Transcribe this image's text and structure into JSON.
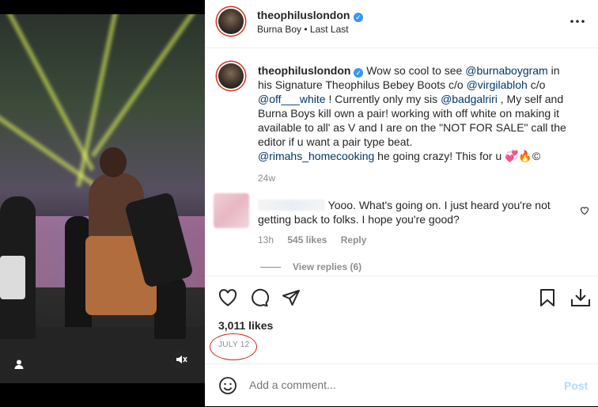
{
  "post": {
    "username": "theophiluslondon",
    "music": "Burna Boy • Last Last"
  },
  "caption": {
    "username": "theophiluslondon",
    "p1": " Wow so cool to see ",
    "m1": "@burnaboygram",
    "p2": " in his Signature Theophilus Bebey Boots c/o ",
    "m2": "@virgilabloh",
    "p3": " c/o ",
    "m3": "@off___white",
    "p4": " ! Currently only my sis ",
    "m4": "@badgalriri",
    "p5": " , My self and Burna Boys kill own a pair! working with off white on making it available to all' as V and I are on the \"NOT FOR SALE\" call the editor if u want a pair type beat.",
    "m5": "@rimahs_homecooking",
    "p6": " he going crazy! This for u 💞🔥©",
    "time": "24w"
  },
  "comment": {
    "text": "Yooo. What's going on. I just heard you're not getting back to folks. I hope you're good?",
    "time": "13h",
    "likes": "545 likes",
    "reply": "Reply",
    "view_replies": "View replies (6)"
  },
  "stats": {
    "likes": "3,011 likes",
    "date": "JULY 12"
  },
  "add_comment": {
    "placeholder": "Add a comment...",
    "post_label": "Post"
  },
  "colors": {
    "verified": "#3897f0",
    "mention": "#00376b",
    "post_button": "#b3dbff",
    "annotation_circle": "#d0281f"
  },
  "icons": {
    "more": "more-options-icon",
    "like": "heart-icon",
    "comment": "comment-bubble-icon",
    "share": "paper-plane-icon",
    "save": "bookmark-icon",
    "download": "download-icon",
    "emoji": "emoji-icon",
    "user": "user-tag-icon",
    "mute": "muted-speaker-icon"
  }
}
